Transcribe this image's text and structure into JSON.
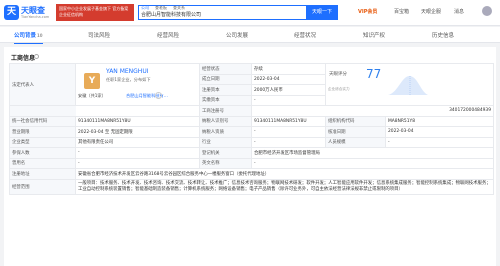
{
  "brand": {
    "name": "天眼查",
    "url": "TianYancha.com",
    "banner": "国家中小企业发展子基金旗下 官方备案企业征信机构"
  },
  "search": {
    "tabs": [
      "公司",
      "查老板",
      "查关系"
    ],
    "value": "合肥山月智能科技有限公司",
    "button": "天眼一下"
  },
  "nav": {
    "vip": "VIP会员",
    "items": [
      "百宝箱",
      "天眼企服",
      "消息"
    ]
  },
  "tabs": [
    {
      "label": "公司背景",
      "count": "10",
      "active": true
    },
    {
      "label": "司法风险",
      "count": "",
      "active": false
    },
    {
      "label": "经营风险",
      "count": "",
      "active": false
    },
    {
      "label": "公司发展",
      "count": "",
      "active": false
    },
    {
      "label": "经营状况",
      "count": "",
      "active": false
    },
    {
      "label": "知识产权",
      "count": "",
      "active": false
    },
    {
      "label": "历史信息",
      "count": "",
      "active": false
    }
  ],
  "section": {
    "title": "工商信息"
  },
  "legal": {
    "label": "法定代表人",
    "avatar": "Y",
    "name": "YAN MENGHUI",
    "sub": "任职1家企业，分布如下",
    "region": "安徽（共1家）",
    "company": "合肥山月智能科技有…"
  },
  "rows": {
    "status": {
      "label": "经营状态",
      "value": "存续"
    },
    "est": {
      "label": "成立日期",
      "value": "2022-03-04"
    },
    "reg_cap": {
      "label": "注册资本",
      "value": "2000万人民币"
    },
    "paid_cap": {
      "label": "实缴资本",
      "value": "-"
    },
    "biz_reg": {
      "label": "工商注册号",
      "value": "340172000484939"
    },
    "credit": {
      "label": "统一社会信用代码",
      "value": "91340111MA8NR51Y8U"
    },
    "tax_id": {
      "label": "纳税人识别号",
      "value": "91340111MA8NR51Y8U"
    },
    "org_code": {
      "label": "组织机构代码",
      "value": "MA8NR51Y8"
    },
    "term": {
      "label": "营业期限",
      "value": "2022-03-04 至 无固定期限"
    },
    "taxpayer": {
      "label": "纳税人资质",
      "value": "-"
    },
    "approve": {
      "label": "核准日期",
      "value": "2022-03-04"
    },
    "type": {
      "label": "企业类型",
      "value": "其他有限责任公司"
    },
    "industry": {
      "label": "行业",
      "value": "-"
    },
    "staff": {
      "label": "人员规模",
      "value": "-"
    },
    "insured": {
      "label": "参保人数",
      "value": "-"
    },
    "authority": {
      "label": "登记机关",
      "value": "合肥市经济开发区市场监督管理局"
    },
    "former": {
      "label": "曾用名",
      "value": "-"
    },
    "en_name": {
      "label": "英文名称",
      "value": "-"
    },
    "address": {
      "label": "注册地址",
      "value": "安徽省合肥市经济技术开发区云谷路3168号云谷园区综合服务中心一楼服务窗口（委托代理地址）"
    },
    "scope": {
      "label": "经营范围",
      "value": "一般项目：技术服务、技术开发、技术咨询、技术交流、技术转让、技术推广；信息技术咨询服务；物联网技术研发；软件开发；人工智能应用软件开发；信息系统集成服务；智能控制系统集成；物联网技术服务；工业自动控制系统装置销售；智能基础制造装备销售；计算机系统服务；网络设备销售；电子产品销售（除许可业务外，可自主依法经营法律法规非禁止或限制的项目）"
    }
  },
  "score": {
    "label": "天眼评分",
    "value": "77",
    "caption": "企业综合实力"
  }
}
